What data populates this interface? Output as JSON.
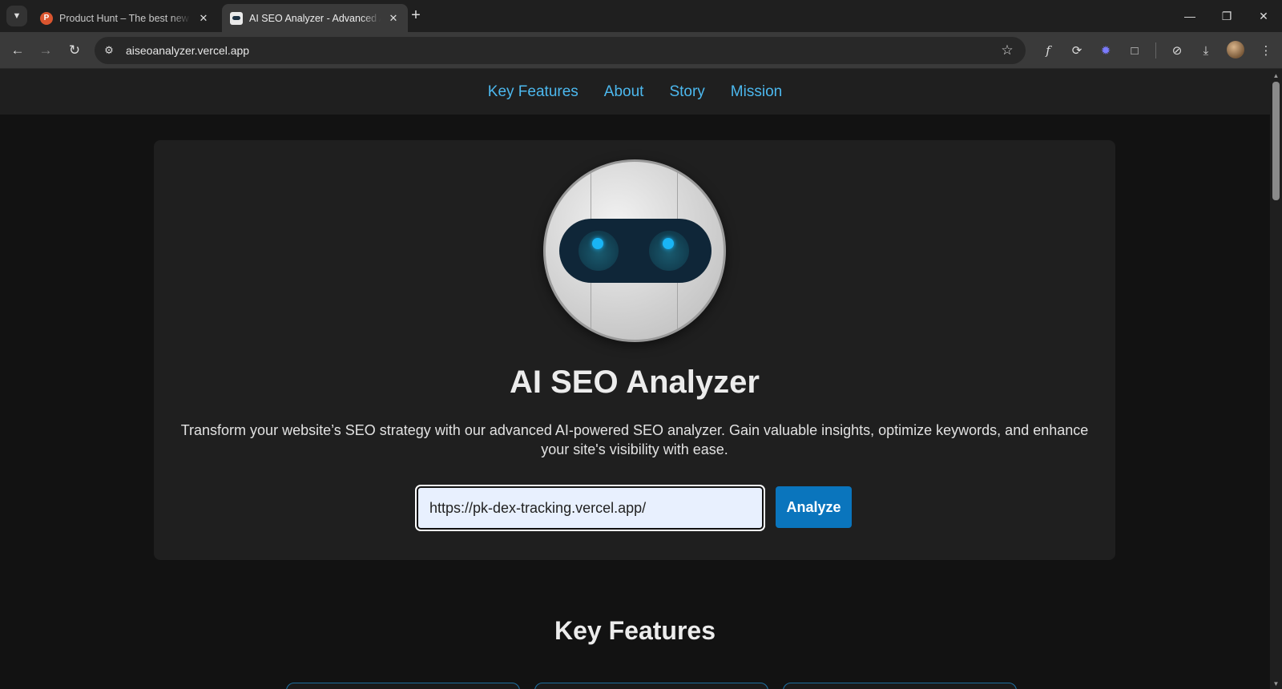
{
  "browser": {
    "tabs": [
      {
        "title": "Product Hunt – The best new products in tech.",
        "favicon": "product-hunt-icon",
        "active": false
      },
      {
        "title": "AI SEO Analyzer - Advanced AI-powered SEO",
        "favicon": "robot-icon",
        "active": true
      }
    ],
    "address": "aiseoanalyzer.vercel.app"
  },
  "site": {
    "nav": [
      "Key Features",
      "About",
      "Story",
      "Mission"
    ],
    "hero": {
      "title": "AI SEO Analyzer",
      "description": "Transform your website’s SEO strategy with our advanced AI-powered SEO analyzer. Gain valuable insights, optimize keywords, and enhance your site's visibility with ease.",
      "input_value": "https://pk-dex-tracking.vercel.app/",
      "button": "Analyze"
    },
    "features_title": "Key Features"
  },
  "colors": {
    "nav_link": "#4cb8ee",
    "button": "#0a75bd",
    "eye_glow": "#19b4f5"
  }
}
